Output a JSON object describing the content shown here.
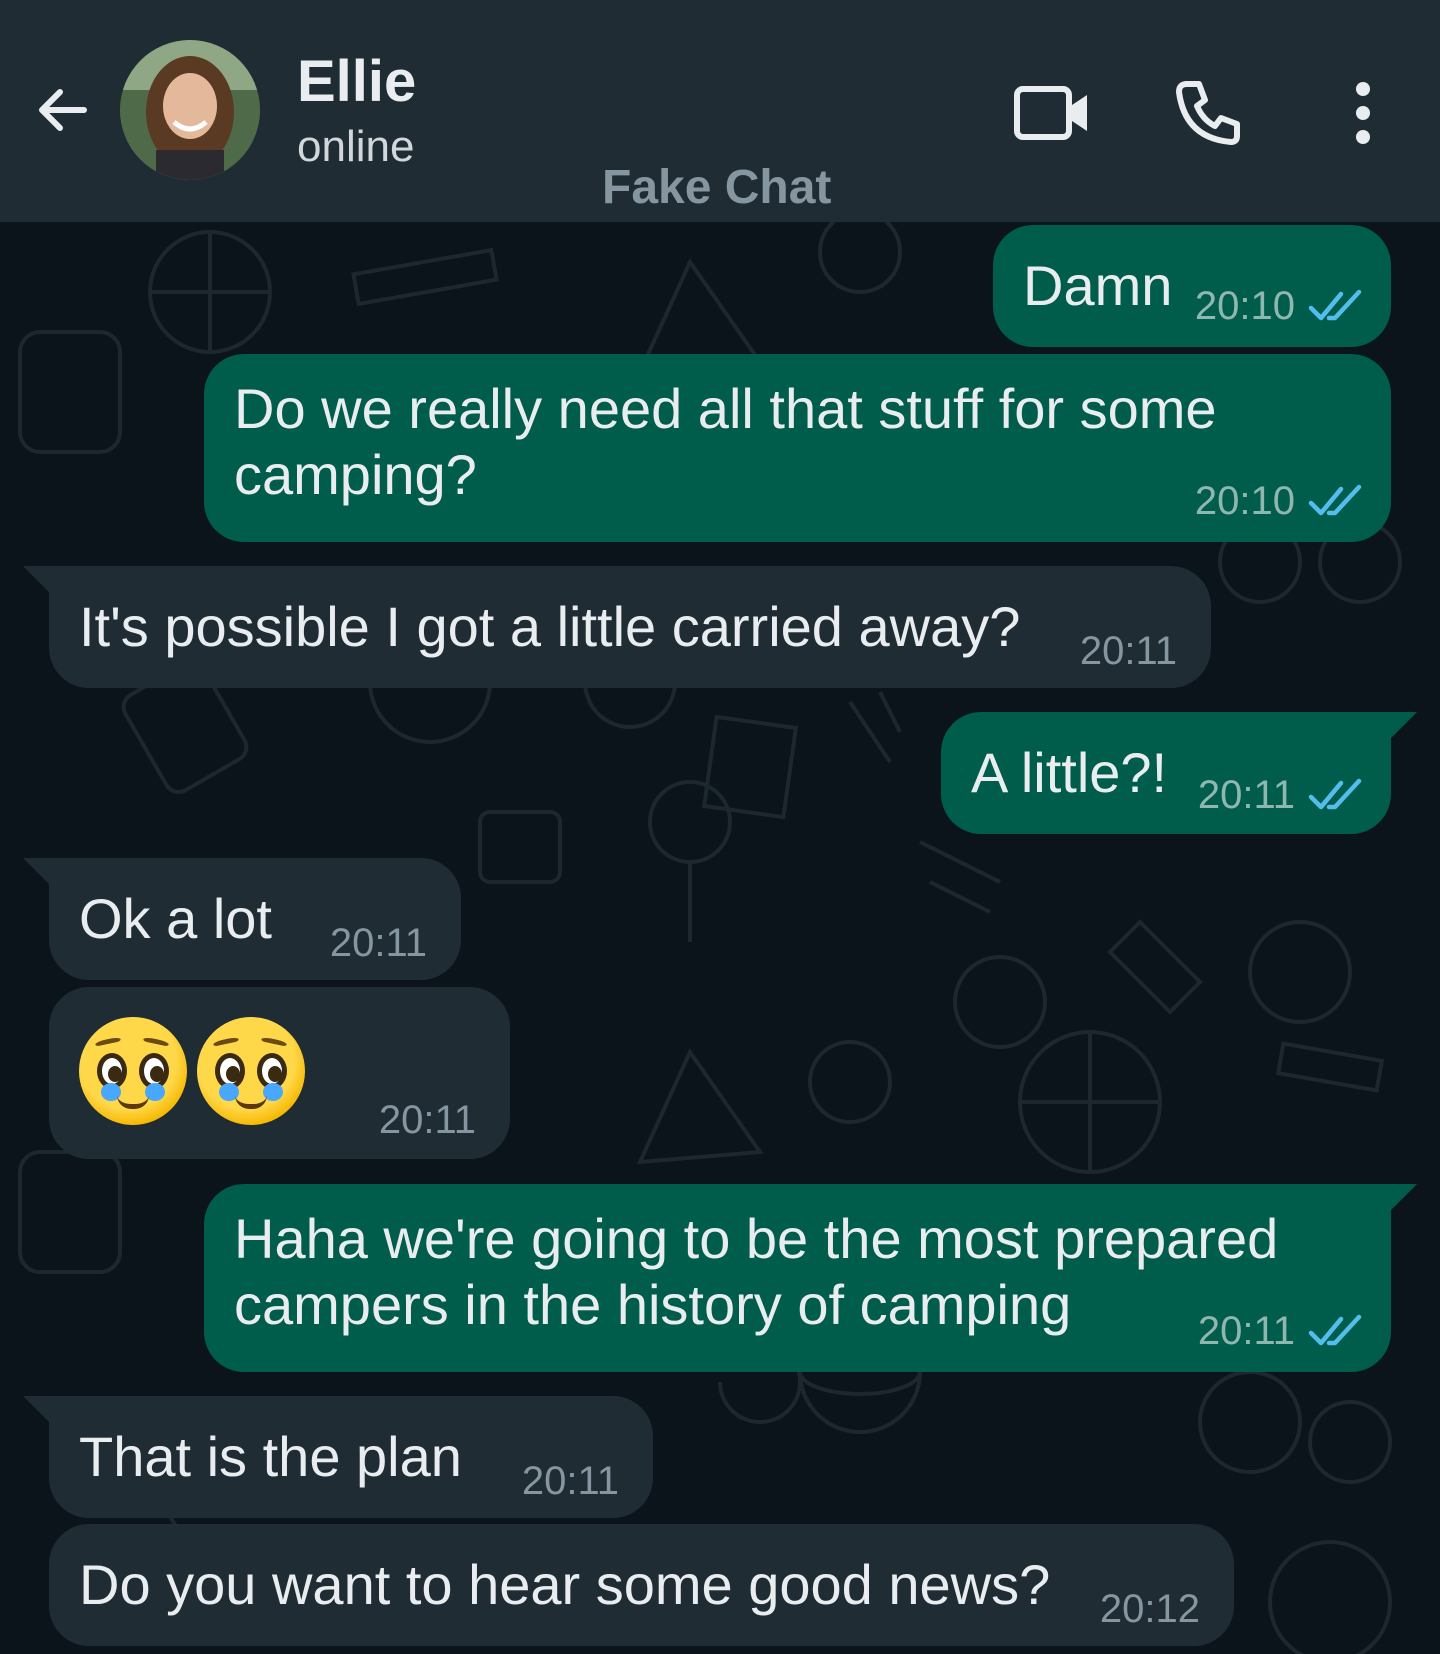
{
  "header": {
    "back_icon": "arrow-left-icon",
    "contact_name": "Ellie",
    "status": "online",
    "app_title": "Fake Chat",
    "video_icon": "video-camera-icon",
    "call_icon": "phone-icon",
    "menu_icon": "more-vertical-icon"
  },
  "colors": {
    "header_bg": "#1f2c34",
    "chat_bg": "#0b141a",
    "outgoing_bubble": "#005c4b",
    "incoming_bubble": "#1f2c34",
    "read_ticks": "#53bdeb"
  },
  "messages": [
    {
      "direction": "out",
      "text": "Damn",
      "time": "20:10",
      "status": "read"
    },
    {
      "direction": "out",
      "text_line1": "Do we really need all that stuff for some",
      "text_line2": "camping?",
      "time": "20:10",
      "status": "read"
    },
    {
      "direction": "in",
      "text": "It's possible I got a little carried away?",
      "time": "20:11"
    },
    {
      "direction": "out",
      "text": "A little?!",
      "time": "20:11",
      "status": "read"
    },
    {
      "direction": "in",
      "text": "Ok a lot",
      "time": "20:11"
    },
    {
      "direction": "in",
      "emoji": "pleading-face-emoji x2",
      "time": "20:11"
    },
    {
      "direction": "out",
      "text_line1": "Haha we're going to be the most prepared",
      "text_line2": "campers in the history of camping",
      "time": "20:11",
      "status": "read"
    },
    {
      "direction": "in",
      "text": "That is the plan",
      "time": "20:11"
    },
    {
      "direction": "in",
      "text": "Do you want to hear some good news?",
      "time": "20:12"
    }
  ]
}
